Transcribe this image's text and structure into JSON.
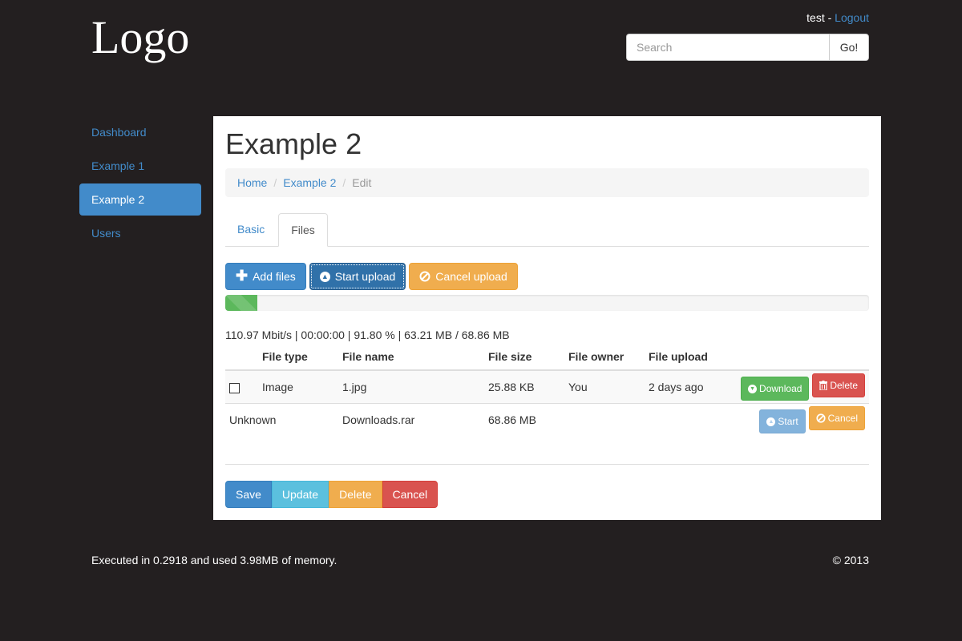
{
  "header": {
    "logo": "Logo",
    "user_name": "test",
    "user_sep": " - ",
    "logout_label": "Logout",
    "search_placeholder": "Search",
    "search_button": "Go!"
  },
  "sidebar": {
    "items": [
      {
        "label": "Dashboard"
      },
      {
        "label": "Example 1"
      },
      {
        "label": "Example 2",
        "active": true
      },
      {
        "label": "Users"
      }
    ]
  },
  "main": {
    "title": "Example 2",
    "breadcrumb": {
      "home": "Home",
      "section": "Example 2",
      "current": "Edit",
      "separator": "/"
    },
    "tabs": [
      {
        "label": "Basic"
      },
      {
        "label": "Files",
        "active": true
      }
    ],
    "toolbar": {
      "add_files": "Add files",
      "start_upload": "Start upload",
      "cancel_upload": "Cancel upload"
    },
    "progress_percent": 5,
    "stats": "110.97 Mbit/s | 00:00:00 | 91.80 % | 63.21 MB / 68.86 MB",
    "table": {
      "headers": [
        "",
        "File type",
        "File name",
        "File size",
        "File owner",
        "File upload",
        ""
      ],
      "rows": [
        {
          "type": "Image",
          "name": "1.jpg",
          "size": "25.88 KB",
          "owner": "You",
          "uploaded": "2 days ago",
          "btn1": "Download",
          "btn2": "Delete"
        },
        {
          "type": "Unknown",
          "name": "Downloads.rar",
          "size": "68.86 MB",
          "btn1": "Start",
          "btn2": "Cancel"
        }
      ]
    },
    "form_actions": {
      "save": "Save",
      "update": "Update",
      "delete": "Delete",
      "cancel": "Cancel"
    }
  },
  "footer": {
    "stats": "Executed in 0.2918 and used 3.98MB of memory.",
    "copyright": "© 2013"
  },
  "colors": {
    "background": "#231f20",
    "primary": "#428bca",
    "success": "#5cb85c",
    "warning": "#f0ad4e",
    "danger": "#d9534f",
    "info": "#5bc0de"
  }
}
